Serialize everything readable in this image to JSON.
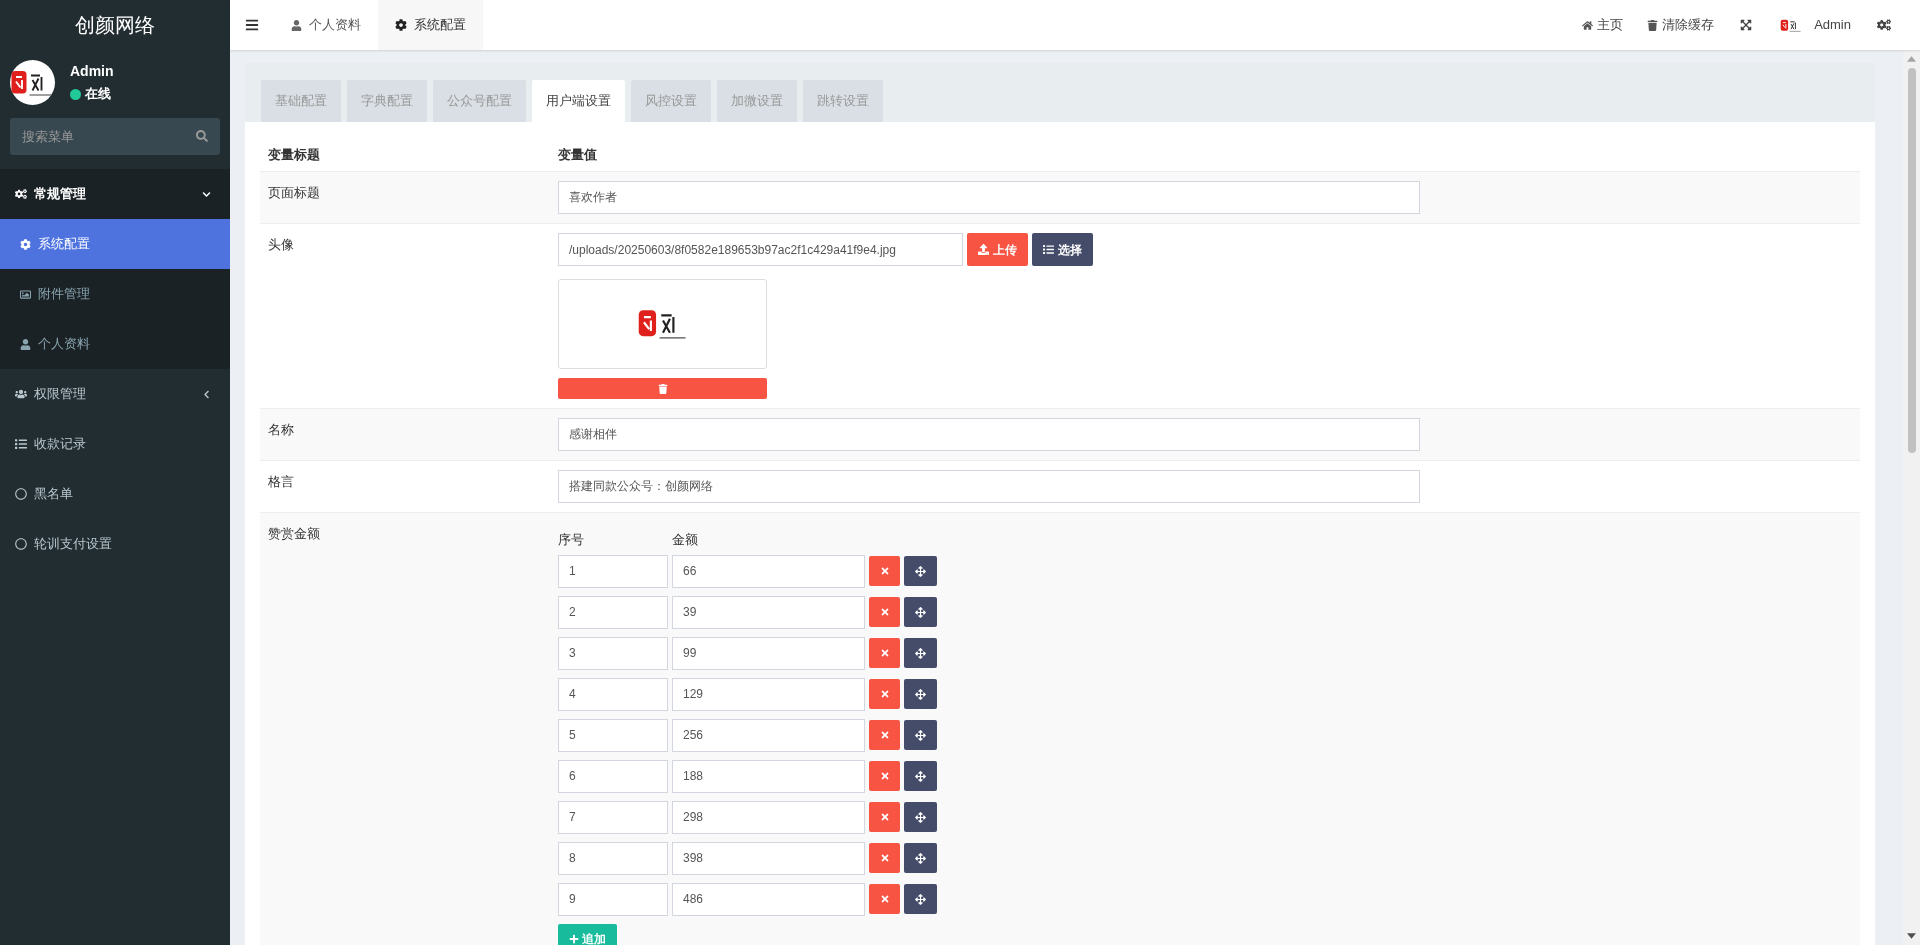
{
  "sidebar": {
    "brand": "创颜网络",
    "user": {
      "name": "Admin",
      "status": "在线"
    },
    "search": {
      "placeholder": "搜索菜单"
    },
    "menu": [
      {
        "kind": "group",
        "label": "常规管理",
        "expanded": true,
        "children": [
          {
            "label": "系统配置",
            "selected": true
          },
          {
            "label": "附件管理",
            "selected": false
          },
          {
            "label": "个人资料",
            "selected": false
          }
        ]
      },
      {
        "kind": "group",
        "label": "权限管理",
        "expanded": false
      },
      {
        "kind": "item",
        "label": "收款记录",
        "selected": false
      },
      {
        "kind": "item",
        "label": "黑名单",
        "selected": false
      },
      {
        "kind": "item",
        "label": "轮训支付设置",
        "selected": false
      }
    ]
  },
  "topbar": {
    "tabs": [
      {
        "label": "个人资料",
        "selected": false
      },
      {
        "label": "系统配置",
        "selected": true
      }
    ],
    "actions": [
      "主页",
      "清除缓存"
    ],
    "user": "Admin"
  },
  "panel": {
    "tabs": [
      {
        "label": "基础配置",
        "selected": false
      },
      {
        "label": "字典配置",
        "selected": false
      },
      {
        "label": "公众号配置",
        "selected": false
      },
      {
        "label": "用户端设置",
        "selected": true
      },
      {
        "label": "风控设置",
        "selected": false
      },
      {
        "label": "加微设置",
        "selected": false
      },
      {
        "label": "跳转设置",
        "selected": false
      }
    ],
    "table": {
      "columns": [
        "变量标题",
        "变量值"
      ],
      "rows": [
        {
          "kind": "text",
          "label": "页面标题",
          "value": "喜欢作者"
        },
        {
          "kind": "image",
          "label": "头像",
          "value": "/uploads/20250603/8f0582e189653b97ac2f1c429a41f9e4.jpg",
          "buttons": [
            "上传",
            "选择"
          ]
        },
        {
          "kind": "text",
          "label": "名称",
          "value": "感谢相伴"
        },
        {
          "kind": "text",
          "label": "格言",
          "value": "搭建同款公众号：创颜网络"
        },
        {
          "kind": "list",
          "label": "赞赏金额",
          "columns": [
            "序号",
            "金额"
          ],
          "add_button": "追加",
          "items": [
            {
              "seq": "1",
              "amount": "66"
            },
            {
              "seq": "2",
              "amount": "39"
            },
            {
              "seq": "3",
              "amount": "99"
            },
            {
              "seq": "4",
              "amount": "129"
            },
            {
              "seq": "5",
              "amount": "256"
            },
            {
              "seq": "6",
              "amount": "188"
            },
            {
              "seq": "7",
              "amount": "298"
            },
            {
              "seq": "8",
              "amount": "398"
            },
            {
              "seq": "9",
              "amount": "486"
            }
          ]
        }
      ]
    }
  }
}
